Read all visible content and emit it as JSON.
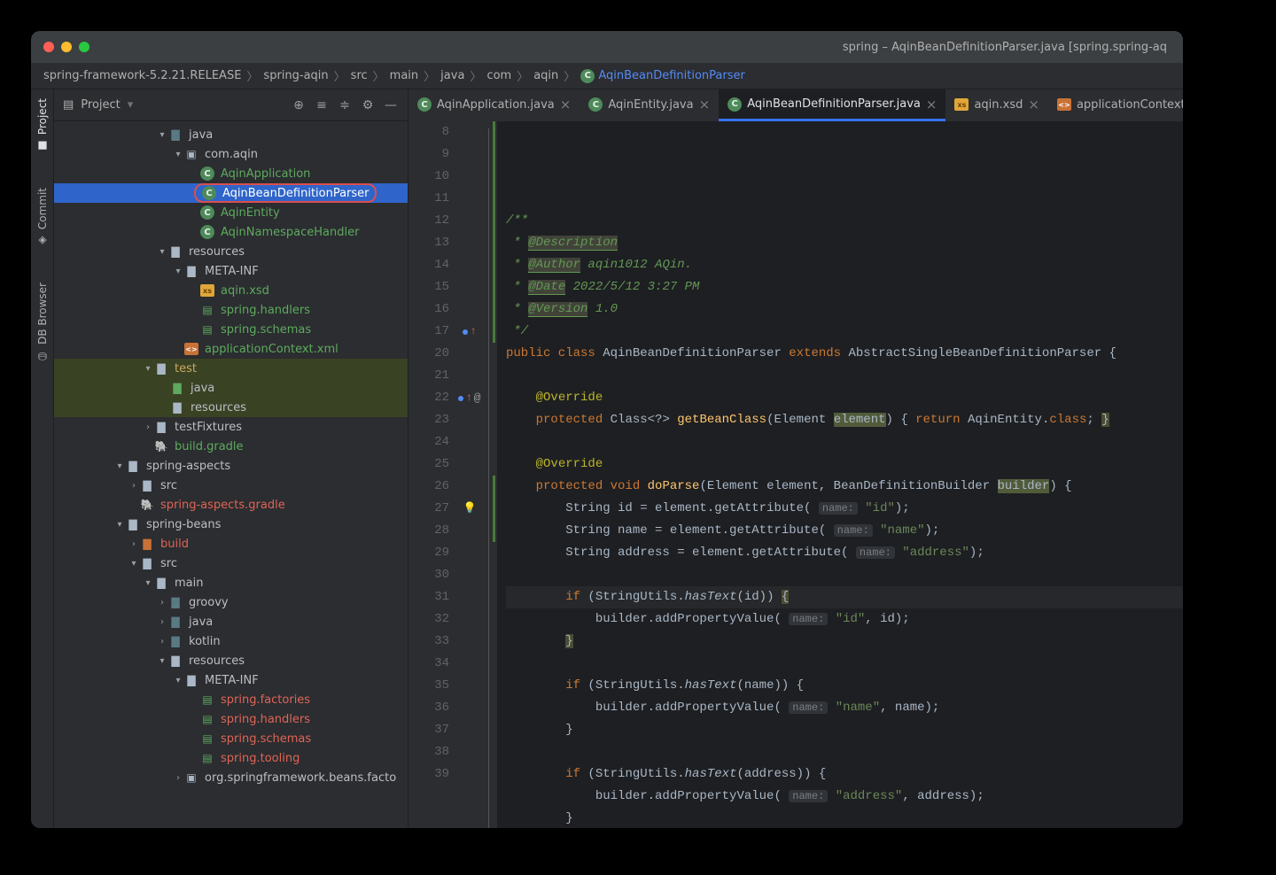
{
  "titlebar": {
    "title": "spring – AqinBeanDefinitionParser.java [spring.spring-aq"
  },
  "breadcrumbs": [
    "spring-framework-5.2.21.RELEASE",
    "spring-aqin",
    "src",
    "main",
    "java",
    "com",
    "aqin",
    "AqinBeanDefinitionParser"
  ],
  "rail": {
    "project": "Project",
    "commit": "Commit",
    "db": "DB Browser"
  },
  "project_header": {
    "label": "Project"
  },
  "tree": {
    "java": "java",
    "pkg": "com.aqin",
    "cls1": "AqinApplication",
    "cls2": "AqinBeanDefinitionParser",
    "cls3": "AqinEntity",
    "cls4": "AqinNamespaceHandler",
    "resources": "resources",
    "metainf": "META-INF",
    "xsd": "aqin.xsd",
    "handlers": "spring.handlers",
    "schemas": "spring.schemas",
    "appctx": "applicationContext.xml",
    "test": "test",
    "javatest": "java",
    "restest": "resources",
    "fixtures": "testFixtures",
    "bg": "build.gradle",
    "aspects": "spring-aspects",
    "src": "src",
    "aspectsg": "spring-aspects.gradle",
    "beans": "spring-beans",
    "build": "build",
    "main": "main",
    "groovy": "groovy",
    "javam": "java",
    "kotlin": "kotlin",
    "resm": "resources",
    "metam": "META-INF",
    "sf": "spring.factories",
    "sh": "spring.handlers",
    "ss": "spring.schemas",
    "st": "spring.tooling",
    "orgpkg": "org.springframework.beans.facto"
  },
  "tabs": [
    {
      "label": "AqinApplication.java",
      "icon": "class"
    },
    {
      "label": "AqinEntity.java",
      "icon": "class"
    },
    {
      "label": "AqinBeanDefinitionParser.java",
      "icon": "class",
      "active": true
    },
    {
      "label": "aqin.xsd",
      "icon": "xsd"
    },
    {
      "label": "applicationContext.xml",
      "icon": "xml"
    }
  ],
  "code": {
    "lines": [
      {
        "n": 8,
        "html": "<span class='c-doc'>/**</span>"
      },
      {
        "n": 9,
        "html": "<span class='c-doc'> * <span class='c-tag'>@Description</span></span>"
      },
      {
        "n": 10,
        "html": "<span class='c-doc'> * <span class='c-tag'>@Author</span> aqin1012 AQin.</span>"
      },
      {
        "n": 11,
        "html": "<span class='c-doc'> * <span class='c-tag'>@Date</span> 2022/5/12 3:27 PM</span>"
      },
      {
        "n": 12,
        "html": "<span class='c-doc'> * <span class='c-tag'>@Version</span> 1.0</span>"
      },
      {
        "n": 13,
        "html": "<span class='c-doc'> */</span>"
      },
      {
        "n": 14,
        "html": "<span class='c-kw'>public class</span> AqinBeanDefinitionParser <span class='c-kw'>extends</span> AbstractSingleBeanDefinitionParser {"
      },
      {
        "n": 15,
        "html": ""
      },
      {
        "n": 16,
        "html": "    <span class='c-anno'>@Override</span>"
      },
      {
        "n": 17,
        "html": "    <span class='c-kw'>protected</span> Class&lt;?&gt; <span class='c-name'>getBeanClass</span>(Element <span class='c-hl'>element</span>) { <span class='c-kw'>return</span> AqinEntity.<span class='c-kw'>class</span>; <span class='c-brace-hl'>}</span>"
      },
      {
        "n": 20,
        "html": ""
      },
      {
        "n": 21,
        "html": "    <span class='c-anno'>@Override</span>"
      },
      {
        "n": 22,
        "html": "    <span class='c-kw'>protected void</span> <span class='c-name'>doParse</span>(Element element, BeanDefinitionBuilder <span class='c-hl'>builder</span>) {"
      },
      {
        "n": 23,
        "html": "        String id = element.getAttribute( <span class='c-hint'>name:</span> <span class='c-str'>\"id\"</span>);"
      },
      {
        "n": 24,
        "html": "        String name = element.getAttribute( <span class='c-hint'>name:</span> <span class='c-str'>\"name\"</span>);"
      },
      {
        "n": 25,
        "html": "        String address = element.getAttribute( <span class='c-hint'>name:</span> <span class='c-str'>\"address\"</span>);"
      },
      {
        "n": 26,
        "html": ""
      },
      {
        "n": 27,
        "html": "        <span class='c-kw'>if</span> (StringUtils.<span class='c-italic'>hasText</span>(id)) <span class='c-brace-hl'>{</span>",
        "caret": true
      },
      {
        "n": 28,
        "html": "            builder.addPropertyValue( <span class='c-hint'>name:</span> <span class='c-str'>\"id\"</span>, id);"
      },
      {
        "n": 29,
        "html": "        <span class='c-brace-hl'>}</span>"
      },
      {
        "n": 30,
        "html": ""
      },
      {
        "n": 31,
        "html": "        <span class='c-kw'>if</span> (StringUtils.<span class='c-italic'>hasText</span>(name)) {"
      },
      {
        "n": 32,
        "html": "            builder.addPropertyValue( <span class='c-hint'>name:</span> <span class='c-str'>\"name\"</span>, name);"
      },
      {
        "n": 33,
        "html": "        }"
      },
      {
        "n": 34,
        "html": ""
      },
      {
        "n": 35,
        "html": "        <span class='c-kw'>if</span> (StringUtils.<span class='c-italic'>hasText</span>(address)) {"
      },
      {
        "n": 36,
        "html": "            builder.addPropertyValue( <span class='c-hint'>name:</span> <span class='c-str'>\"address\"</span>, address);"
      },
      {
        "n": 37,
        "html": "        }"
      },
      {
        "n": 38,
        "html": "    }"
      },
      {
        "n": 39,
        "html": "}"
      }
    ]
  }
}
